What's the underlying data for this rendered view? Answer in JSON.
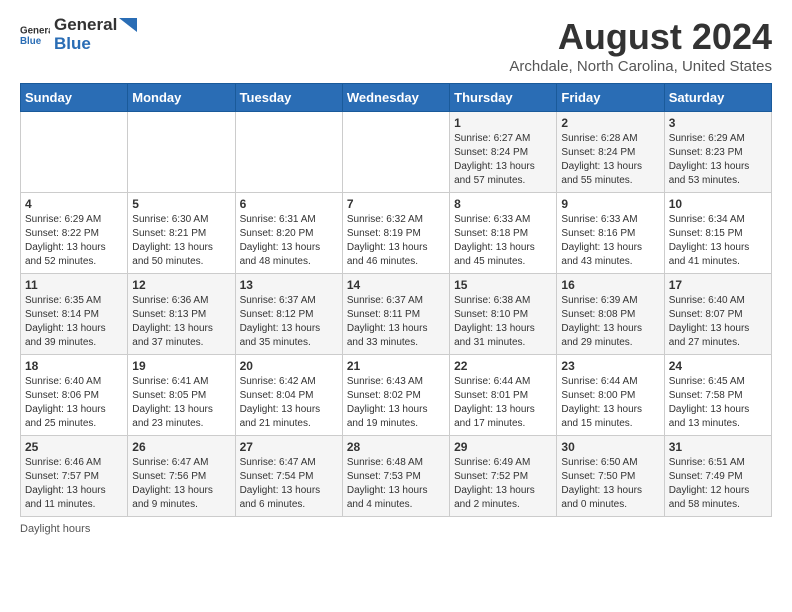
{
  "logo": {
    "general": "General",
    "blue": "Blue"
  },
  "title": "August 2024",
  "subtitle": "Archdale, North Carolina, United States",
  "days_of_week": [
    "Sunday",
    "Monday",
    "Tuesday",
    "Wednesday",
    "Thursday",
    "Friday",
    "Saturday"
  ],
  "weeks": [
    [
      {
        "day": "",
        "info": ""
      },
      {
        "day": "",
        "info": ""
      },
      {
        "day": "",
        "info": ""
      },
      {
        "day": "",
        "info": ""
      },
      {
        "day": "1",
        "info": "Sunrise: 6:27 AM\nSunset: 8:24 PM\nDaylight: 13 hours\nand 57 minutes."
      },
      {
        "day": "2",
        "info": "Sunrise: 6:28 AM\nSunset: 8:24 PM\nDaylight: 13 hours\nand 55 minutes."
      },
      {
        "day": "3",
        "info": "Sunrise: 6:29 AM\nSunset: 8:23 PM\nDaylight: 13 hours\nand 53 minutes."
      }
    ],
    [
      {
        "day": "4",
        "info": "Sunrise: 6:29 AM\nSunset: 8:22 PM\nDaylight: 13 hours\nand 52 minutes."
      },
      {
        "day": "5",
        "info": "Sunrise: 6:30 AM\nSunset: 8:21 PM\nDaylight: 13 hours\nand 50 minutes."
      },
      {
        "day": "6",
        "info": "Sunrise: 6:31 AM\nSunset: 8:20 PM\nDaylight: 13 hours\nand 48 minutes."
      },
      {
        "day": "7",
        "info": "Sunrise: 6:32 AM\nSunset: 8:19 PM\nDaylight: 13 hours\nand 46 minutes."
      },
      {
        "day": "8",
        "info": "Sunrise: 6:33 AM\nSunset: 8:18 PM\nDaylight: 13 hours\nand 45 minutes."
      },
      {
        "day": "9",
        "info": "Sunrise: 6:33 AM\nSunset: 8:16 PM\nDaylight: 13 hours\nand 43 minutes."
      },
      {
        "day": "10",
        "info": "Sunrise: 6:34 AM\nSunset: 8:15 PM\nDaylight: 13 hours\nand 41 minutes."
      }
    ],
    [
      {
        "day": "11",
        "info": "Sunrise: 6:35 AM\nSunset: 8:14 PM\nDaylight: 13 hours\nand 39 minutes."
      },
      {
        "day": "12",
        "info": "Sunrise: 6:36 AM\nSunset: 8:13 PM\nDaylight: 13 hours\nand 37 minutes."
      },
      {
        "day": "13",
        "info": "Sunrise: 6:37 AM\nSunset: 8:12 PM\nDaylight: 13 hours\nand 35 minutes."
      },
      {
        "day": "14",
        "info": "Sunrise: 6:37 AM\nSunset: 8:11 PM\nDaylight: 13 hours\nand 33 minutes."
      },
      {
        "day": "15",
        "info": "Sunrise: 6:38 AM\nSunset: 8:10 PM\nDaylight: 13 hours\nand 31 minutes."
      },
      {
        "day": "16",
        "info": "Sunrise: 6:39 AM\nSunset: 8:08 PM\nDaylight: 13 hours\nand 29 minutes."
      },
      {
        "day": "17",
        "info": "Sunrise: 6:40 AM\nSunset: 8:07 PM\nDaylight: 13 hours\nand 27 minutes."
      }
    ],
    [
      {
        "day": "18",
        "info": "Sunrise: 6:40 AM\nSunset: 8:06 PM\nDaylight: 13 hours\nand 25 minutes."
      },
      {
        "day": "19",
        "info": "Sunrise: 6:41 AM\nSunset: 8:05 PM\nDaylight: 13 hours\nand 23 minutes."
      },
      {
        "day": "20",
        "info": "Sunrise: 6:42 AM\nSunset: 8:04 PM\nDaylight: 13 hours\nand 21 minutes."
      },
      {
        "day": "21",
        "info": "Sunrise: 6:43 AM\nSunset: 8:02 PM\nDaylight: 13 hours\nand 19 minutes."
      },
      {
        "day": "22",
        "info": "Sunrise: 6:44 AM\nSunset: 8:01 PM\nDaylight: 13 hours\nand 17 minutes."
      },
      {
        "day": "23",
        "info": "Sunrise: 6:44 AM\nSunset: 8:00 PM\nDaylight: 13 hours\nand 15 minutes."
      },
      {
        "day": "24",
        "info": "Sunrise: 6:45 AM\nSunset: 7:58 PM\nDaylight: 13 hours\nand 13 minutes."
      }
    ],
    [
      {
        "day": "25",
        "info": "Sunrise: 6:46 AM\nSunset: 7:57 PM\nDaylight: 13 hours\nand 11 minutes."
      },
      {
        "day": "26",
        "info": "Sunrise: 6:47 AM\nSunset: 7:56 PM\nDaylight: 13 hours\nand 9 minutes."
      },
      {
        "day": "27",
        "info": "Sunrise: 6:47 AM\nSunset: 7:54 PM\nDaylight: 13 hours\nand 6 minutes."
      },
      {
        "day": "28",
        "info": "Sunrise: 6:48 AM\nSunset: 7:53 PM\nDaylight: 13 hours\nand 4 minutes."
      },
      {
        "day": "29",
        "info": "Sunrise: 6:49 AM\nSunset: 7:52 PM\nDaylight: 13 hours\nand 2 minutes."
      },
      {
        "day": "30",
        "info": "Sunrise: 6:50 AM\nSunset: 7:50 PM\nDaylight: 13 hours\nand 0 minutes."
      },
      {
        "day": "31",
        "info": "Sunrise: 6:51 AM\nSunset: 7:49 PM\nDaylight: 12 hours\nand 58 minutes."
      }
    ]
  ],
  "footer": "Daylight hours"
}
